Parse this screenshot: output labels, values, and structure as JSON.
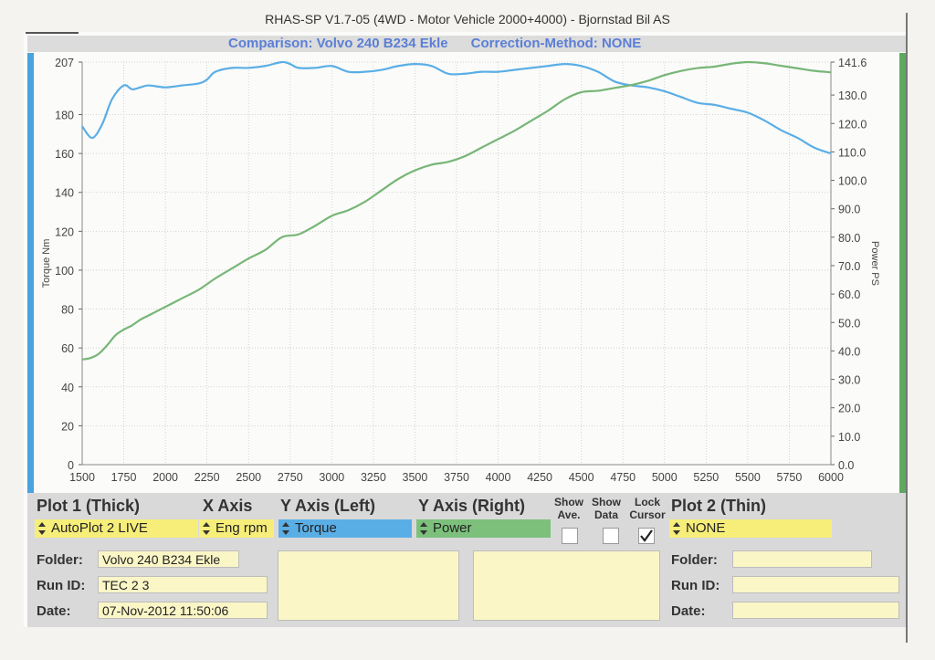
{
  "header": {
    "app_title": "RHAS-SP V1.7-05   (4WD - Motor Vehicle 2000+4000) - Bjornstad Bil AS",
    "comparison": "Comparison: Volvo 240 B234 Ekle      Correction-Method: NONE"
  },
  "colors": {
    "torque": "#5aaee6",
    "power": "#77b677",
    "torque_accent": "#4aa3df",
    "power_accent": "#5fa860",
    "title_blue": "#5b7fd6",
    "field_yellow": "#fbf6c6",
    "select_yellow": "#f7ee7a"
  },
  "chart_data": {
    "type": "line",
    "xlabel": "",
    "ylabel": "Torque Nm",
    "y2label": "Power PS",
    "xlim": [
      1500,
      6000
    ],
    "ylim": [
      0,
      207
    ],
    "y2lim": [
      0,
      141.6
    ],
    "x_ticks": [
      1500,
      1750,
      2000,
      2250,
      2500,
      2750,
      3000,
      3250,
      3500,
      3750,
      4000,
      4250,
      4500,
      4750,
      5000,
      5250,
      5500,
      5750,
      6000
    ],
    "y_ticks": [
      0,
      20,
      40,
      60,
      80,
      100,
      120,
      140,
      160,
      180,
      207
    ],
    "y2_ticks": [
      "0.0",
      "10.0",
      "20.0",
      "30.0",
      "40.0",
      "50.0",
      "60.0",
      "70.0",
      "80.0",
      "90.0",
      "100.0",
      "110.0",
      "120.0",
      "130.0",
      "141.6"
    ],
    "grid": true,
    "series": [
      {
        "name": "Torque",
        "axis": "left",
        "x": [
          1500,
          1560,
          1620,
          1680,
          1750,
          1800,
          1850,
          1900,
          2000,
          2100,
          2200,
          2250,
          2300,
          2400,
          2500,
          2600,
          2700,
          2750,
          2800,
          2900,
          3000,
          3100,
          3200,
          3300,
          3400,
          3500,
          3600,
          3700,
          3800,
          3900,
          4000,
          4100,
          4200,
          4300,
          4400,
          4500,
          4600,
          4700,
          4800,
          4900,
          5000,
          5100,
          5200,
          5300,
          5400,
          5500,
          5600,
          5700,
          5800,
          5900,
          6000
        ],
        "y": [
          174,
          168,
          175,
          188,
          195,
          193,
          194,
          195,
          194,
          195,
          196,
          198,
          202,
          204,
          204,
          205,
          207,
          206,
          204,
          204,
          205,
          202,
          202,
          203,
          205,
          206,
          205,
          201,
          201,
          202,
          202,
          203,
          204,
          205,
          206,
          205,
          202,
          197,
          195,
          194,
          192,
          189,
          186,
          185,
          183,
          181,
          177,
          172,
          168,
          163,
          160
        ]
      },
      {
        "name": "Power",
        "axis": "right",
        "x": [
          1500,
          1550,
          1600,
          1650,
          1700,
          1750,
          1800,
          1850,
          1900,
          2000,
          2100,
          2200,
          2300,
          2400,
          2500,
          2600,
          2700,
          2800,
          2900,
          3000,
          3100,
          3200,
          3300,
          3400,
          3500,
          3600,
          3700,
          3800,
          3900,
          4000,
          4100,
          4200,
          4300,
          4400,
          4500,
          4600,
          4700,
          4800,
          4900,
          5000,
          5100,
          5200,
          5300,
          5400,
          5500,
          5600,
          5700,
          5800,
          5900,
          6000
        ],
        "y": [
          37,
          37.5,
          39,
          42,
          45.5,
          47.5,
          49,
          51,
          52.5,
          55.5,
          58.5,
          61.5,
          65.5,
          69,
          72.5,
          75.5,
          80,
          81,
          84,
          87.5,
          89.5,
          92.5,
          96.5,
          100.5,
          103.5,
          105.5,
          106.5,
          108.5,
          111.5,
          114.5,
          117.5,
          121,
          124.5,
          128.5,
          131,
          131.5,
          132.5,
          133.5,
          135,
          137,
          138.5,
          139.5,
          140,
          141,
          141.6,
          141.2,
          140.3,
          139.4,
          138.5,
          138
        ]
      }
    ]
  },
  "panel": {
    "plot1_title": "Plot 1 (Thick)",
    "x_axis_title": "X Axis",
    "y_left_title": "Y Axis (Left)",
    "y_right_title": "Y Axis (Right)",
    "show_ave_label": "Show\nAve.",
    "show_data_label": "Show\nData",
    "lock_cursor_label": "Lock\nCursor",
    "plot2_title": "Plot 2 (Thin)",
    "plot1_value": "AutoPlot 2 LIVE",
    "x_axis_value": "Eng rpm",
    "y_left_value": "Torque",
    "y_right_value": "Power",
    "plot2_value": "NONE",
    "show_ave_checked": false,
    "show_data_checked": false,
    "lock_cursor_checked": true,
    "left": {
      "folder_label": "Folder:",
      "folder_value": "Volvo 240 B234 Ekle",
      "runid_label": "Run ID:",
      "runid_value": "TEC 2   3",
      "date_label": "Date:",
      "date_value": "07-Nov-2012  11:50:06"
    },
    "right": {
      "folder_label": "Folder:",
      "folder_value": "",
      "runid_label": "Run ID:",
      "runid_value": "",
      "date_label": "Date:",
      "date_value": ""
    }
  }
}
